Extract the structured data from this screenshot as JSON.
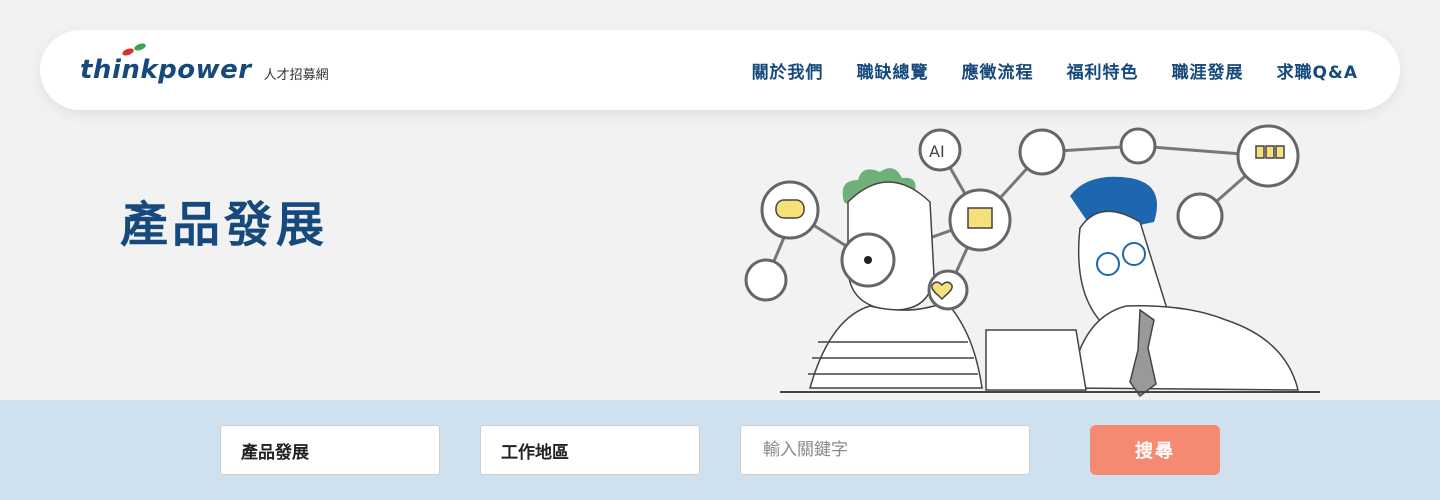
{
  "header": {
    "logo_text": "thinkpower",
    "logo_subtitle": "人才招募網",
    "nav": [
      {
        "label": "關於我們"
      },
      {
        "label": "職缺總覽"
      },
      {
        "label": "應徵流程"
      },
      {
        "label": "福利特色"
      },
      {
        "label": "職涯發展"
      },
      {
        "label": "求職Q&A"
      }
    ]
  },
  "hero": {
    "title": "產品發展",
    "illustration_icons": [
      "ai-icon",
      "chart-icon",
      "org-chart-icon",
      "documents-icon",
      "chat-icon",
      "list-icon",
      "document-icon",
      "heart-icon",
      "trend-icon",
      "magnifier-icon"
    ]
  },
  "search": {
    "category_value": "產品發展",
    "location_value": "工作地區",
    "keyword_placeholder": "輸入關鍵字",
    "button_label": "搜尋"
  },
  "colors": {
    "brand": "#174a7c",
    "accent": "#f48a72",
    "search_bar_bg": "#cfe1ee",
    "page_bg": "#f2f2f2"
  }
}
